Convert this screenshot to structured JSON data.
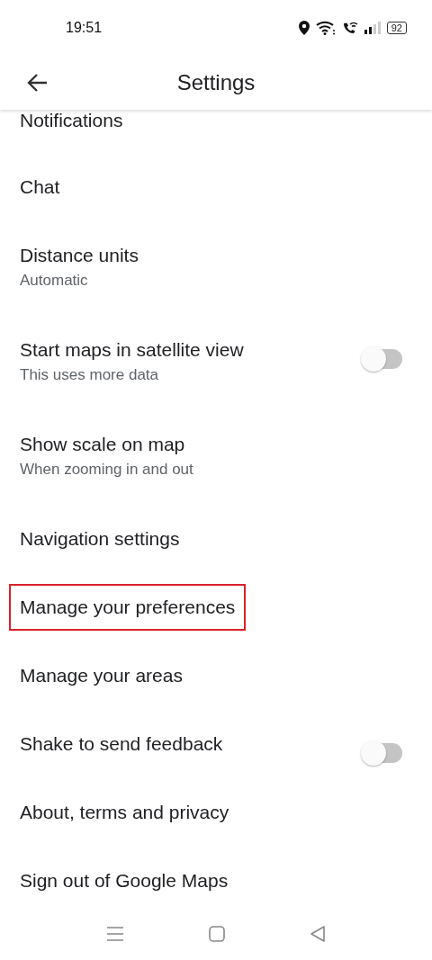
{
  "status_bar": {
    "time": "19:51",
    "battery": "92"
  },
  "header": {
    "title": "Settings"
  },
  "items": [
    {
      "kind": "plain",
      "title": "Notifications",
      "highlighted": false
    },
    {
      "kind": "plain",
      "title": "Chat",
      "highlighted": false
    },
    {
      "kind": "plain",
      "title": "Distance units",
      "subtitle": "Automatic",
      "highlighted": false
    },
    {
      "kind": "toggle",
      "title": "Start maps in satellite view",
      "subtitle": "This uses more data",
      "on": false,
      "highlighted": false
    },
    {
      "kind": "plain",
      "title": "Show scale on map",
      "subtitle": "When zooming in and out",
      "highlighted": false
    },
    {
      "kind": "plain",
      "title": "Navigation settings",
      "highlighted": false
    },
    {
      "kind": "plain",
      "title": "Manage your preferences",
      "highlighted": true
    },
    {
      "kind": "plain",
      "title": "Manage your areas",
      "highlighted": false
    },
    {
      "kind": "toggle",
      "title": "Shake to send feedback",
      "on": false,
      "highlighted": false
    },
    {
      "kind": "plain",
      "title": "About, terms and privacy",
      "highlighted": false
    },
    {
      "kind": "plain",
      "title": "Sign out of Google Maps",
      "highlighted": false
    }
  ]
}
